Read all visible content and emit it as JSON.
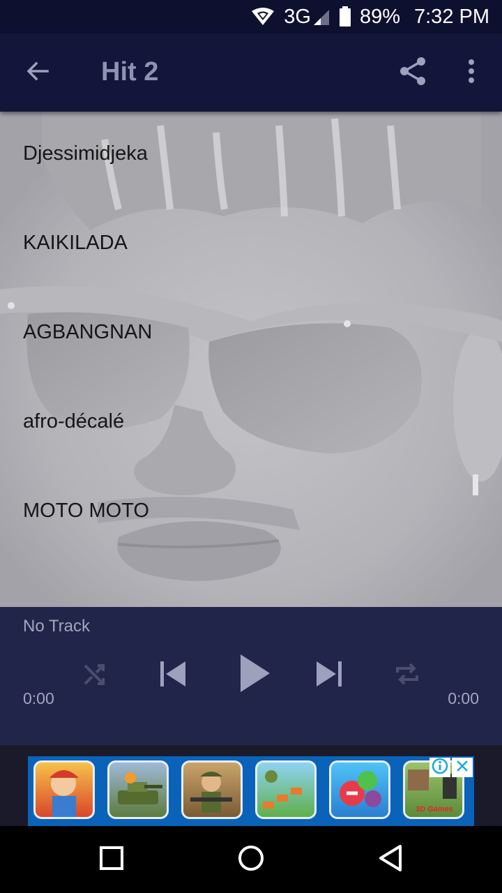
{
  "status_bar": {
    "network": "3G",
    "battery": "89%",
    "time": "7:32 PM",
    "icons": [
      "wifi-icon",
      "signal-icon",
      "battery-icon"
    ]
  },
  "app_bar": {
    "title": "Hit 2",
    "icons": [
      "back-arrow-icon",
      "share-icon",
      "more-vert-icon"
    ]
  },
  "tracks": [
    {
      "label": "Djessimidjeka"
    },
    {
      "label": "KAIKILADA"
    },
    {
      "label": "AGBANGNAN"
    },
    {
      "label": "afro-décalé"
    },
    {
      "label": "MOTO MOTO"
    }
  ],
  "player": {
    "track_name": "No Track",
    "elapsed": "0:00",
    "duration": "0:00",
    "icons": [
      "shuffle-icon",
      "skip-previous-icon",
      "play-icon",
      "skip-next-icon",
      "repeat-icon"
    ]
  },
  "ad": {
    "caption": "3D Games",
    "tiles": [
      "subway-runner",
      "tank-battle",
      "army-soldier",
      "jungle-run",
      "candy-match",
      "3d-games"
    ],
    "icons": [
      "ad-info-icon",
      "ad-close-icon"
    ]
  },
  "nav_bar": {
    "icons": [
      "recents-icon",
      "home-icon",
      "back-icon"
    ]
  },
  "colors": {
    "status_bar": "#0e1030",
    "app_bar": "#13163a",
    "player": "#22254a",
    "title_text": "#8f93b2",
    "ad_banner": "#0a63b8"
  }
}
